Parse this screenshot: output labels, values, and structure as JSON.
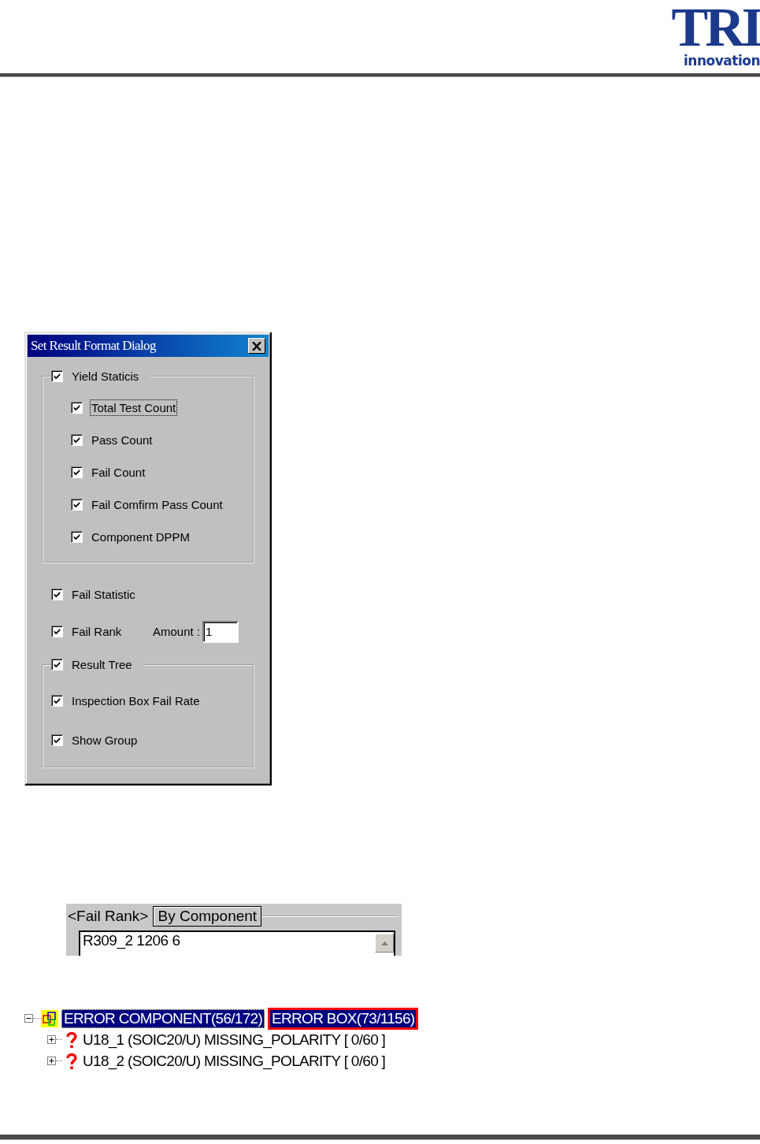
{
  "logo": {
    "mark": "TRI",
    "tagline": "innovation"
  },
  "dialog": {
    "title": "Set Result Format Dialog",
    "yield_group": {
      "label": "Yield Staticis",
      "checked": true,
      "items": [
        {
          "label": "Total Test Count",
          "checked": true,
          "focused": true
        },
        {
          "label": "Pass Count",
          "checked": true,
          "focused": false
        },
        {
          "label": "Fail Count",
          "checked": true,
          "focused": false
        },
        {
          "label": "Fail Comfirm Pass Count",
          "checked": true,
          "focused": false
        },
        {
          "label": "Component DPPM",
          "checked": true,
          "focused": false
        }
      ]
    },
    "fail_statistic": {
      "label": "Fail Statistic",
      "checked": true
    },
    "fail_rank": {
      "label": "Fail Rank",
      "checked": true,
      "amount_label": "Amount :",
      "amount_value": "1"
    },
    "result_tree": {
      "label": "Result Tree",
      "checked": true,
      "items": [
        {
          "label": "Inspection Box Fail Rate",
          "checked": true
        },
        {
          "label": "Show Group",
          "checked": true
        }
      ]
    }
  },
  "fail_rank_panel": {
    "title": "<Fail Rank>",
    "tab": "By Component",
    "value": "R309_2 1206 6"
  },
  "tree": {
    "label": "ERROR COMPONENT(56/172)",
    "box_label": "ERROR BOX(73/1156)",
    "expanded": true,
    "selected": true,
    "children": [
      {
        "label": "U18_1 (SOIC20/U) MISSING_POLARITY [ 0/60 ]",
        "expanded": false
      },
      {
        "label": "U18_2 (SOIC20/U) MISSING_POLARITY [ 0/60 ]",
        "expanded": false
      }
    ]
  }
}
